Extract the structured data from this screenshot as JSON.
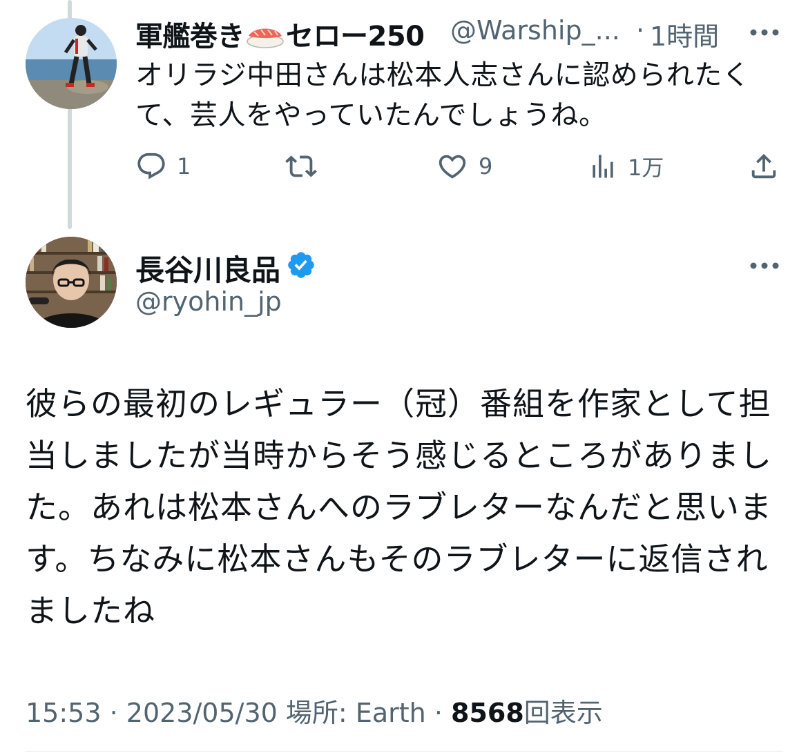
{
  "reply_tweet": {
    "author_name_prefix": "軍艦巻き",
    "author_name_suffix": "セロー250",
    "author_emoji": "sushi-icon",
    "handle": "@Warship_...",
    "separator": "·",
    "time": "1時間",
    "text": "オリラジ中田さんは松本人志さんに認められたくて、芸人をやっていたんでしょうね。",
    "actions": {
      "reply_count": "1",
      "retweet_count": "",
      "like_count": "9",
      "views_count": "1万"
    }
  },
  "main_tweet": {
    "author_name": "長谷川良品",
    "verified": true,
    "handle": "@ryohin_jp",
    "text": "彼らの最初のレギュラー（冠）番組を作家として担当しましたが当時からそう感じるところがありました。あれは松本さんへのラブレターなんだと思います。ちなみに松本さんもそのラブレターに返信されましたね",
    "meta": {
      "time": "15:53",
      "sep1": "·",
      "date": "2023/05/30",
      "location_label": "場所:",
      "location": "Earth",
      "sep2": "·",
      "views": "8568",
      "views_label": "回表示"
    }
  },
  "colors": {
    "text": "#0f1419",
    "secondary": "#536471",
    "thread_line": "#cfd9de",
    "verified_badge": "#1d9bf0",
    "divider": "#eff3f4"
  }
}
